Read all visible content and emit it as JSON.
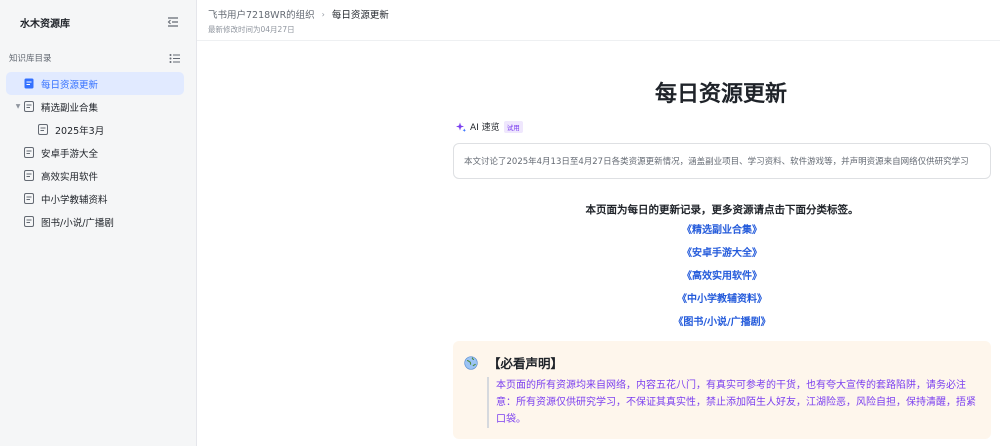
{
  "sidebar": {
    "title": "水木资源库",
    "section_label": "知识库目录",
    "items": [
      {
        "label": "每日资源更新"
      },
      {
        "label": "精选副业合集"
      },
      {
        "label": "2025年3月"
      },
      {
        "label": "安卓手游大全"
      },
      {
        "label": "高效实用软件"
      },
      {
        "label": "中小学教辅资料"
      },
      {
        "label": "图书/小说/广播剧"
      }
    ]
  },
  "header": {
    "breadcrumb_org": "飞书用户7218WR的组织",
    "breadcrumb_current": "每日资源更新",
    "modified": "最新修改时间为04月27日"
  },
  "doc": {
    "title": "每日资源更新",
    "ai_label": "AI 速览",
    "ai_badge": "试用",
    "ai_summary": "本文讨论了2025年4月13日至4月27日各类资源更新情况，涵盖副业项目、学习资料、软件游戏等，并声明资源来自网络仅供研究学习",
    "intro": "本页面为每日的更新记录，更多资源请点击下面分类标签。",
    "links": [
      "《精选副业合集》",
      "《安卓手游大全》",
      "《高效实用软件》",
      "《中小学教辅资料》",
      "《图书/小说/广播剧》"
    ],
    "notice_title": "【必看声明】",
    "notice_body": "本页面的所有资源均来自网络，内容五花八门，有真实可参考的干货，也有夸大宣传的套路陷阱，请务必注意：所有资源仅供研究学习，不保证其真实性，禁止添加陌生人好友，江湖险恶，风险自担，保持清醒，捂紧口袋。"
  },
  "colors": {
    "accent": "#3370ff",
    "link": "#245bdb",
    "notice_bg": "#fef6ec",
    "notice_text": "#7b3ff0"
  },
  "icons": [
    "collapse-sidebar-icon",
    "list-icon",
    "doc-icon",
    "caret-down-icon",
    "breadcrumb-chevron-icon",
    "ai-sparkle-icon",
    "globe-icon"
  ]
}
